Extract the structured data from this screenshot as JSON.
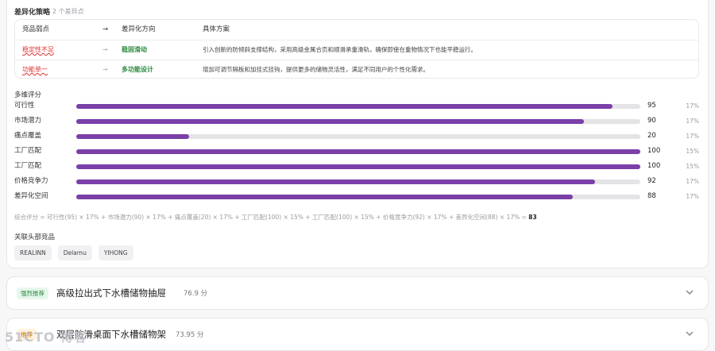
{
  "diff_strategy": {
    "title": "差异化策略",
    "subtitle": "2 个差异点",
    "headers": {
      "weak": "竞品弱点",
      "arrow": "→",
      "direction": "差异化方向",
      "plan": "具体方案"
    },
    "rows": [
      {
        "weak": "稳定性不足",
        "arrow": "→",
        "direction": "稳固滑动",
        "plan": "引入创新的防倾斜支撑结构，采用高级金属合页和顺滑承重滑轨，确保即使在重物情况下也能平稳运行。"
      },
      {
        "weak": "功能单一",
        "arrow": "→",
        "direction": "多功能设计",
        "plan": "增加可调节隔板和加挂式挂钩，提供更多的储物灵活性，满足不同用户的个性化需求。"
      }
    ]
  },
  "scores": {
    "title": "多维评分",
    "items": [
      {
        "label": "可行性",
        "value": 95,
        "weight": "17%"
      },
      {
        "label": "市场潜力",
        "value": 90,
        "weight": "17%"
      },
      {
        "label": "痛点覆盖",
        "value": 20,
        "weight": "17%"
      },
      {
        "label": "工厂匹配",
        "value": 100,
        "weight": "15%"
      },
      {
        "label": "工厂匹配",
        "value": 100,
        "weight": "15%"
      },
      {
        "label": "价格竞争力",
        "value": 92,
        "weight": "17%"
      },
      {
        "label": "差异化空间",
        "value": 88,
        "weight": "17%"
      }
    ],
    "formula_prefix": "综合评分 = 可行性(95) × 17% + 市场潜力(90) × 17% + 痛点覆盖(20) × 17% + 工厂匹配(100) × 15% + 工厂匹配(100) × 15% + 价格竞争力(92) × 17% + 差异化空间(88) × 17% = ",
    "formula_total": "83",
    "bar_color": "#7b3fa8"
  },
  "related": {
    "title": "关联头部竞品",
    "tags": [
      "REALINN",
      "Delamu",
      "YIHONG"
    ]
  },
  "accordions": [
    {
      "badge": "强烈推荐",
      "title": "高级拉出式下水槽储物抽屉",
      "score": "76.9 分"
    },
    {
      "badge": "推荐",
      "title": "双层防滑桌面下水槽储物架",
      "score": "73.95 分"
    }
  ],
  "watermark": "51CTO 博客"
}
